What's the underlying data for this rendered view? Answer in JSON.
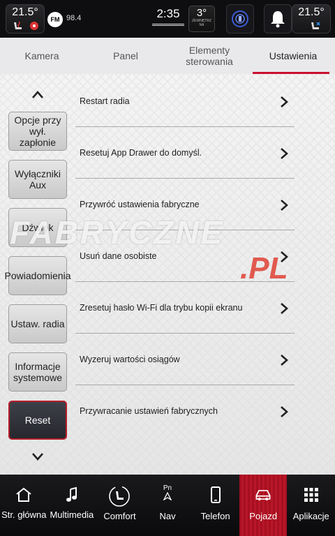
{
  "status": {
    "left_temp": "21.5°",
    "right_temp": "21.5°",
    "radio_band": "FM",
    "radio_freq": "98.4",
    "time": "2:35",
    "outside_temp": "3°",
    "outside_label_1": "ZEWNĘTRZ",
    "outside_label_2": "NA"
  },
  "tabs": [
    {
      "label": "Kamera"
    },
    {
      "label": "Panel"
    },
    {
      "label": "Elementy sterowania"
    },
    {
      "label": "Ustawienia"
    }
  ],
  "side_menu": [
    {
      "label": "Opcje przy wył. zapłonie"
    },
    {
      "label": "Wyłączniki Aux"
    },
    {
      "label": "Dźwięk"
    },
    {
      "label": "Powiadomienia"
    },
    {
      "label": "Ustaw. radia"
    },
    {
      "label": "Informacje systemowe"
    },
    {
      "label": "Reset"
    }
  ],
  "rows": [
    {
      "label": "Restart radia"
    },
    {
      "label": "Resetuj App Drawer do domyśl."
    },
    {
      "label": "Przywróć ustawienia fabryczne"
    },
    {
      "label": "Usuń dane osobiste"
    },
    {
      "label": "Zresetuj hasło Wi-Fi dla trybu kopii ekranu"
    },
    {
      "label": "Wyzeruj wartości osiągów"
    },
    {
      "label": "Przywracanie ustawień fabrycznych"
    }
  ],
  "watermark": {
    "text": "FABRYCZNE",
    "suffix": ".PL"
  },
  "bottom_nav": [
    {
      "label": "Str. główna",
      "icon": "home-icon"
    },
    {
      "label": "Multimedia",
      "icon": "music-note-icon"
    },
    {
      "label": "Comfort",
      "icon": "comfort-icon"
    },
    {
      "label": "Nav",
      "icon": "navigation-icon",
      "sub": "Pn"
    },
    {
      "label": "Telefon",
      "icon": "phone-icon"
    },
    {
      "label": "Pojazd",
      "icon": "car-icon"
    },
    {
      "label": "Aplikacje",
      "icon": "apps-grid-icon"
    }
  ],
  "colors": {
    "accent": "#c8102e",
    "active_nav": "#b8162a",
    "background_main": "#eeeeee"
  }
}
